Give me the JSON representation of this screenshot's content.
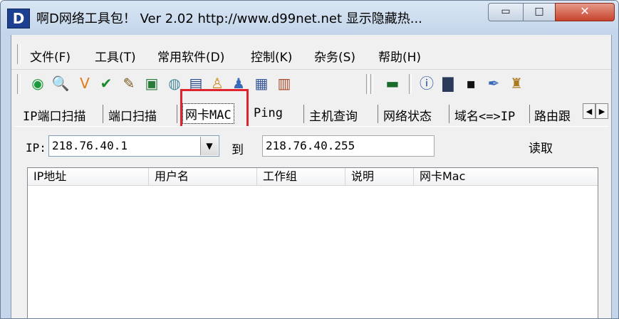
{
  "window": {
    "app_icon_letter": "D",
    "title": "啊D网络工具包！ Ver 2.02  http://www.d99net.net  显示隐藏热...",
    "min_glyph": "▭",
    "max_glyph": "□",
    "close_glyph": "✕"
  },
  "menu": [
    {
      "label": "文件(F)"
    },
    {
      "label": "工具(T)"
    },
    {
      "label": "常用软件(D)"
    },
    {
      "label": "控制(K)"
    },
    {
      "label": "杂务(S)"
    },
    {
      "label": "帮助(H)"
    }
  ],
  "toolbar": [
    {
      "icon": "ping-scan-icon",
      "glyph": "◉",
      "color": "#1a9a3a"
    },
    {
      "icon": "magnifier-icon",
      "glyph": "🔍",
      "color": "#2a4a9a"
    },
    {
      "icon": "colorful-v-icon",
      "glyph": "V",
      "color": "#e07a10"
    },
    {
      "icon": "checkmark-icon",
      "glyph": "✔",
      "color": "#1a8a2a"
    },
    {
      "icon": "broom-icon",
      "glyph": "✎",
      "color": "#7a5a20"
    },
    {
      "icon": "monitor-chart-icon",
      "glyph": "▣",
      "color": "#2a7a3a"
    },
    {
      "icon": "globe-icon",
      "glyph": "◍",
      "color": "#4a8a9a"
    },
    {
      "icon": "network-computers-icon",
      "glyph": "▤",
      "color": "#2a4a8a"
    },
    {
      "icon": "candle-icon",
      "glyph": "♙",
      "color": "#d08a20"
    },
    {
      "icon": "users-icon",
      "glyph": "♟",
      "color": "#3a6aba"
    },
    {
      "icon": "lan-icon",
      "glyph": "▦",
      "color": "#3a5a9a"
    },
    {
      "icon": "remote-screen-icon",
      "glyph": "▥",
      "color": "#aa4a2a"
    },
    {
      "icon": "network-card-icon",
      "glyph": "▬",
      "color": "#1a6a2a"
    },
    {
      "icon": "info-bubble-icon",
      "glyph": "ⓘ",
      "color": "#1a4a9a"
    },
    {
      "icon": "computer-icon",
      "glyph": "▇",
      "color": "#2a3a5a"
    },
    {
      "icon": "cmd-console-icon",
      "glyph": "▪",
      "color": "#111111"
    },
    {
      "icon": "pen-tool-icon",
      "glyph": "✒",
      "color": "#3a6aba"
    },
    {
      "icon": "connect-icon",
      "glyph": "♜",
      "color": "#aa7a20"
    }
  ],
  "tabs": [
    {
      "label": "IP端口扫描"
    },
    {
      "label": "端口扫描"
    },
    {
      "label": "网卡MAC"
    },
    {
      "label": "Ping"
    },
    {
      "label": "主机查询"
    },
    {
      "label": "网络状态"
    },
    {
      "label": "域名<=>IP"
    },
    {
      "label": "路由跟"
    }
  ],
  "tab_scroll": {
    "left": "◀",
    "right": "▶"
  },
  "form": {
    "ip_label": "IP:",
    "ip_from": "218.76.40.1",
    "combo_arrow": "▼",
    "to_label": "到",
    "ip_to": "218.76.40.255",
    "read_button": "读取"
  },
  "table": {
    "columns": [
      "IP地址",
      "用户名",
      "工作组",
      "说明",
      "网卡Mac"
    ],
    "rows": []
  }
}
